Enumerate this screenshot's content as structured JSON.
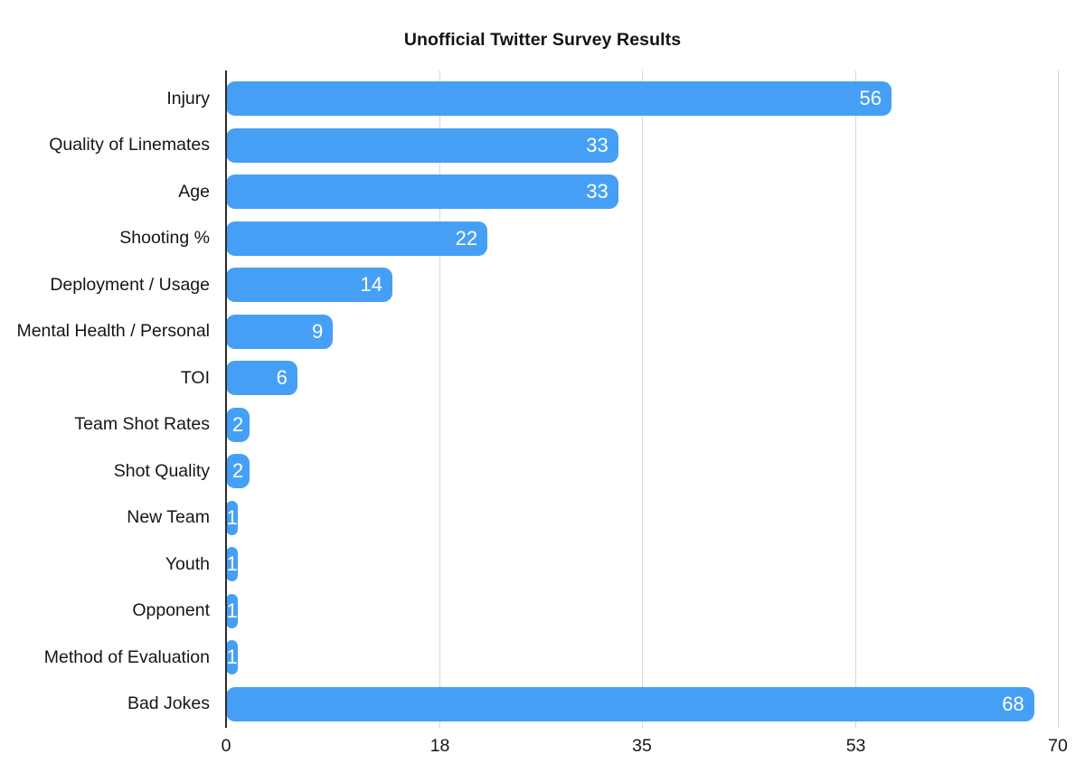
{
  "chart_data": {
    "type": "bar",
    "orientation": "horizontal",
    "title": "Unofficial Twitter Survey Results",
    "xlabel": "",
    "ylabel": "",
    "xlim": [
      0,
      70
    ],
    "xticks": [
      "0",
      "18",
      "35",
      "53",
      "70"
    ],
    "xtick_values": [
      0,
      18,
      35,
      53,
      70
    ],
    "grid": true,
    "legend": false,
    "bar_color": "#45a0f5",
    "value_label_color": "#ffffff",
    "axis_color": "#2c2c2c",
    "gridline_color": "#d8d8d8",
    "background_color": "#ffffff",
    "categories": [
      "Injury",
      "Quality of Linemates",
      "Age",
      "Shooting %",
      "Deployment / Usage",
      "Mental Health / Personal",
      "TOI",
      "Team Shot Rates",
      "Shot Quality",
      "New Team",
      "Youth",
      "Opponent",
      "Method of Evaluation",
      "Bad Jokes"
    ],
    "values": [
      56,
      33,
      33,
      22,
      14,
      9,
      6,
      2,
      2,
      1,
      1,
      1,
      1,
      68
    ],
    "value_labels": [
      "56",
      "33",
      "33",
      "22",
      "14",
      "9",
      "6",
      "2",
      "2",
      "1",
      "1",
      "1",
      "1",
      "68"
    ]
  }
}
